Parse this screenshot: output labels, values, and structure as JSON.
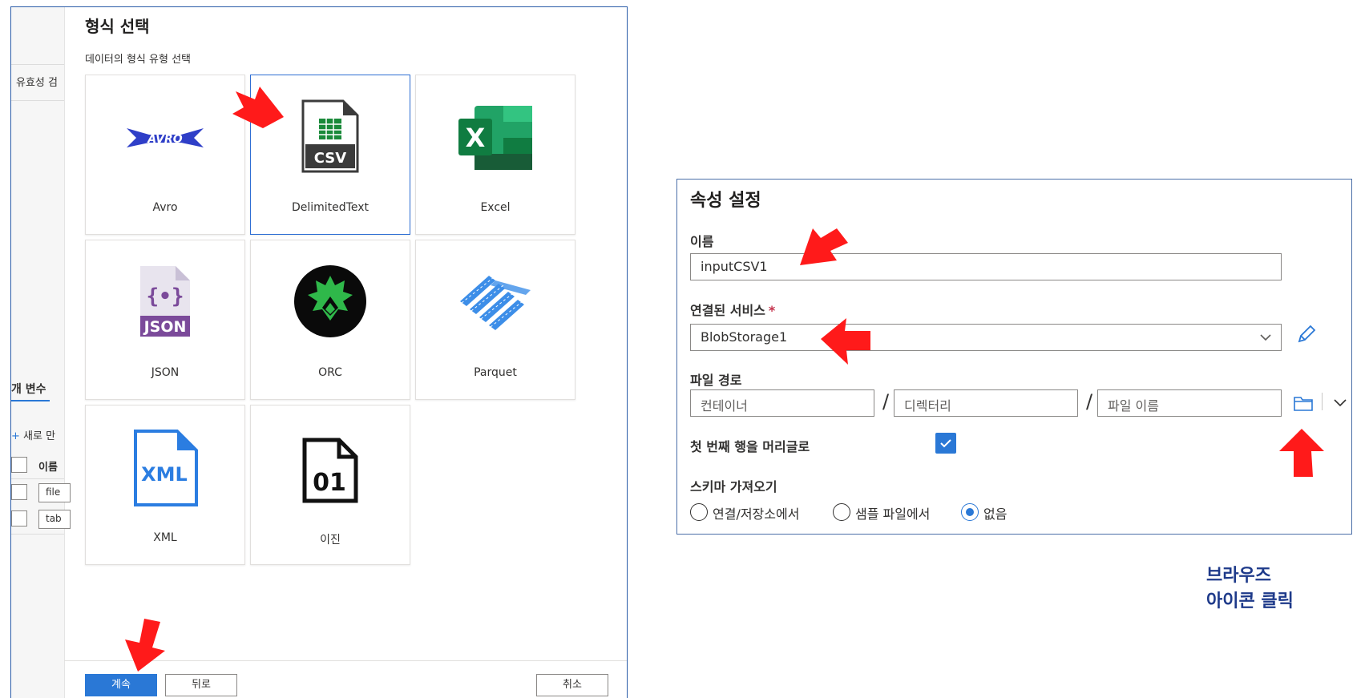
{
  "left_panel": {
    "background_sidebar": {
      "validation_label": "유효성 검",
      "params_label": "개 변수",
      "new_label": "새로 만",
      "name_label": "이름",
      "row1_value": "file",
      "row2_value": "tab"
    },
    "title": "형식 선택",
    "subtitle": "데이터의 형식 유형 선택",
    "tiles": [
      {
        "label": "Avro",
        "icon": "avro-logo-icon"
      },
      {
        "label": "DelimitedText",
        "icon": "csv-file-icon",
        "selected": true
      },
      {
        "label": "Excel",
        "icon": "excel-icon"
      },
      {
        "label": "JSON",
        "icon": "json-file-icon"
      },
      {
        "label": "ORC",
        "icon": "orc-logo-icon"
      },
      {
        "label": "Parquet",
        "icon": "parquet-logo-icon"
      },
      {
        "label": "XML",
        "icon": "xml-file-icon"
      },
      {
        "label": "이진",
        "icon": "binary-file-icon"
      }
    ],
    "icon_text": {
      "avro": "AVRO",
      "csv": "CSV",
      "excel": "X",
      "json": "JSON",
      "xml": "XML",
      "binary": "01"
    },
    "footer": {
      "continue": "계속",
      "back": "뒤로",
      "cancel": "취소"
    }
  },
  "right_panel": {
    "title": "속성 설정",
    "name_label": "이름",
    "name_value": "inputCSV1",
    "linked_service_label": "연결된 서비스",
    "required_mark": "*",
    "linked_service_value": "BlobStorage1",
    "file_path_label": "파일 경로",
    "container_placeholder": "컨테이너",
    "directory_placeholder": "디렉터리",
    "filename_placeholder": "파일 이름",
    "path_separator": "/",
    "first_row_header_label": "첫 번째 행을 머리글로",
    "first_row_header_checked": true,
    "import_schema_label": "스키마 가져오기",
    "import_schema_options": [
      "연결/저장소에서",
      "샘플 파일에서",
      "없음"
    ],
    "import_schema_selected": "없음"
  },
  "annotation": {
    "line1": "브라우즈",
    "line2": "아이콘 클릭"
  },
  "colors": {
    "accent": "#2a78d6",
    "arrow": "#ff1a1a",
    "annotation": "#1e3a8a"
  }
}
